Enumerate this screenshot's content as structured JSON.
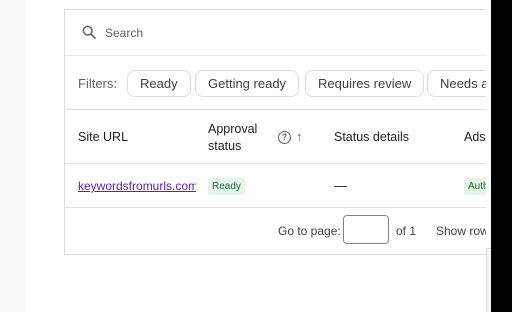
{
  "search": {
    "placeholder": "Search"
  },
  "filters": {
    "label": "Filters:",
    "chips": [
      "Ready",
      "Getting ready",
      "Requires review",
      "Needs at"
    ]
  },
  "table": {
    "columns": {
      "site_url": "Site URL",
      "approval_status": "Approval status",
      "help_glyph": "?",
      "sort_glyph": "↑",
      "status_details": "Status details",
      "ads": "Ads."
    },
    "rows": [
      {
        "site_url": "keywordsfromurls.com",
        "approval_status": "Ready",
        "status_details": "—",
        "ads": "Auth"
      }
    ]
  },
  "pagination": {
    "go_to_label": "Go to page:",
    "page_value": "",
    "of_label": "of 1",
    "show_rows_label": "Show rows"
  },
  "colors": {
    "link": "#681da8",
    "badge_bg": "#e6f4ea",
    "badge_text": "#137333",
    "border": "#dadce0"
  },
  "icons": {
    "search": "search-icon",
    "help": "help-circle-icon",
    "sort": "arrow-up-icon"
  }
}
